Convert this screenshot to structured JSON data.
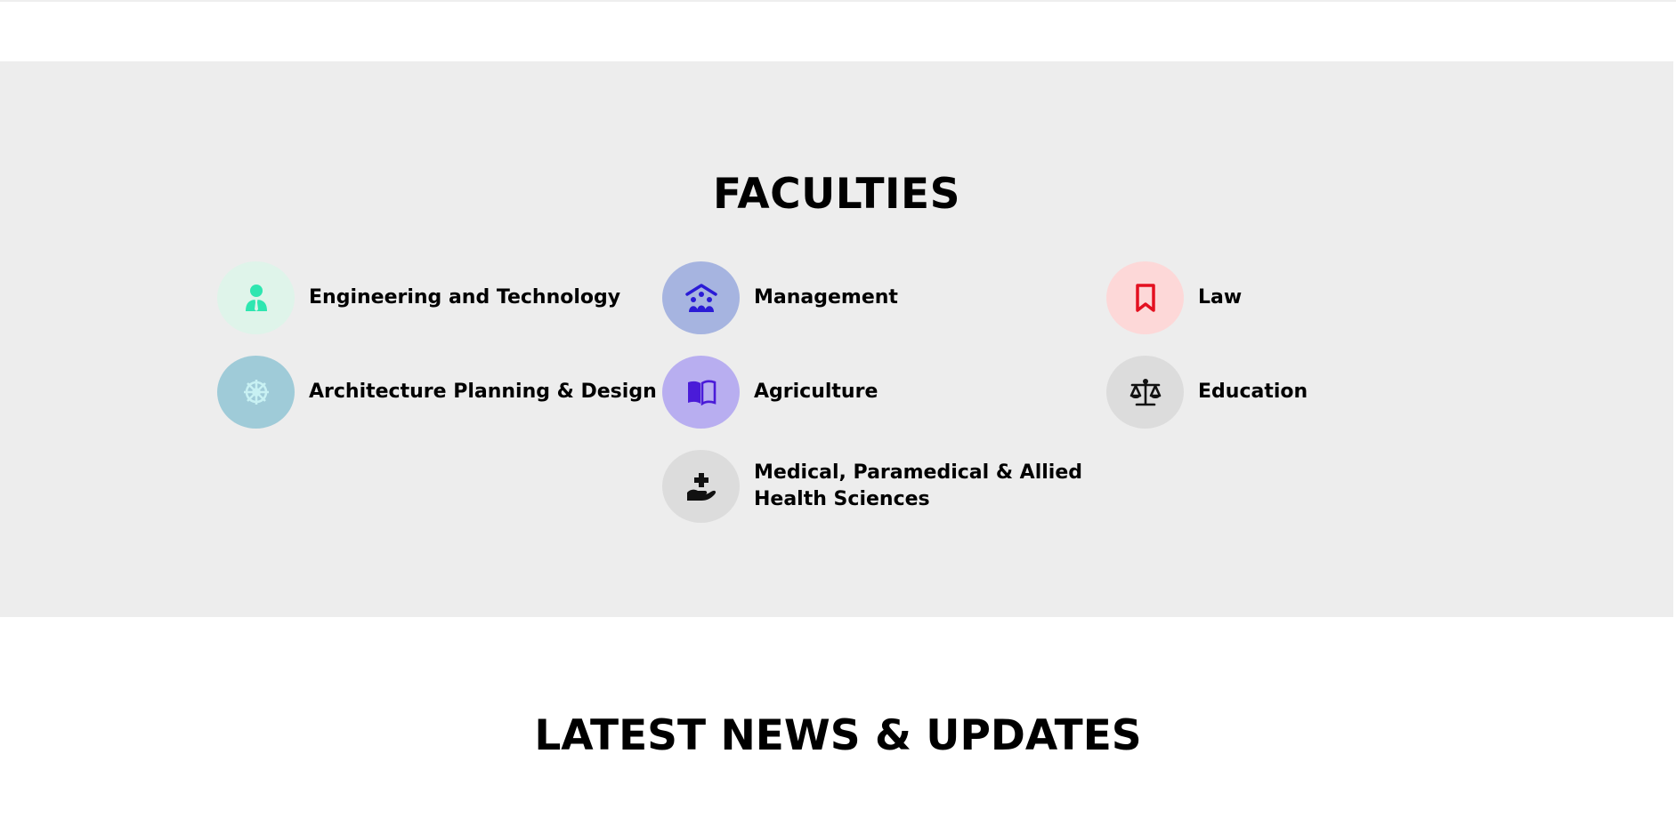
{
  "faculties": {
    "title": "FACULTIES",
    "items": [
      {
        "label": "Engineering and Technology",
        "icon": "user-tie-icon",
        "bg": "#dff4ea",
        "color": "#2ee6b0"
      },
      {
        "label": "Management",
        "icon": "people-roof-icon",
        "bg": "#a6b4e0",
        "color": "#2a1bd6"
      },
      {
        "label": "Law",
        "icon": "bookmark-icon",
        "bg": "#fdd8d8",
        "color": "#e41020"
      },
      {
        "label": "Architecture Planning & Design",
        "icon": "dharma-wheel-icon",
        "bg": "#9fcbd8",
        "color": "#c8f1f3"
      },
      {
        "label": "Agriculture",
        "icon": "book-open-icon",
        "bg": "#b8aef0",
        "color": "#4a1bd8"
      },
      {
        "label": "Education",
        "icon": "scale-balanced-icon",
        "bg": "#dcdcdc",
        "color": "#111111"
      },
      {
        "label": "Medical, Paramedical & Allied Health Sciences",
        "icon": "hand-holding-medical-icon",
        "bg": "#dcdcdc",
        "color": "#111111"
      }
    ]
  },
  "news": {
    "title": "LATEST NEWS & UPDATES"
  },
  "colors": {
    "section_bg": "#ededed",
    "page_bg": "#ffffff"
  }
}
